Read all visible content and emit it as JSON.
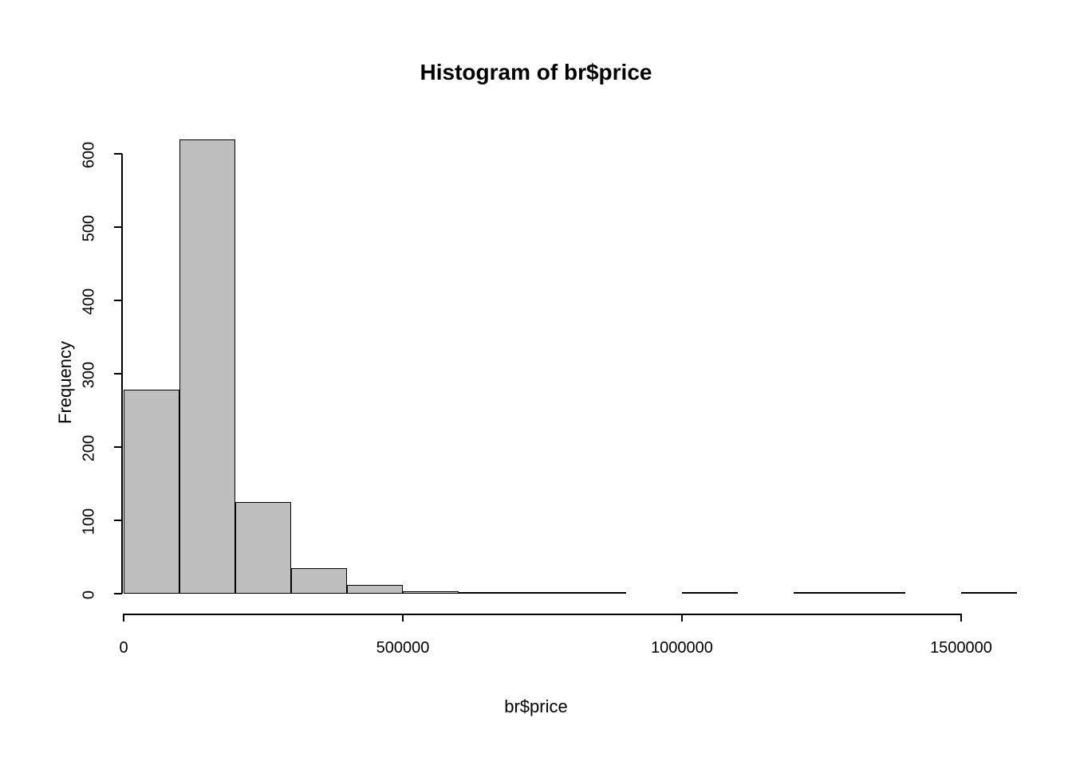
{
  "chart_data": {
    "type": "bar",
    "title": "Histogram of br$price",
    "xlabel": "br$price",
    "ylabel": "Frequency",
    "bin_width": 100000,
    "bin_edges": [
      0,
      100000,
      200000,
      300000,
      400000,
      500000,
      600000,
      700000,
      800000,
      900000,
      1000000,
      1100000,
      1200000,
      1300000,
      1400000,
      1500000,
      1600000
    ],
    "values": [
      278,
      620,
      125,
      35,
      12,
      3,
      2,
      1,
      1,
      0,
      1,
      0,
      1,
      1,
      0,
      1
    ],
    "ylim": [
      0,
      620
    ],
    "xlim": [
      0,
      1600000
    ],
    "y_ticks": [
      0,
      100,
      200,
      300,
      400,
      500,
      600
    ],
    "x_ticks": [
      0,
      500000,
      1000000,
      1500000
    ],
    "x_tick_labels": [
      "0",
      "500000",
      "1000000",
      "1500000"
    ]
  }
}
